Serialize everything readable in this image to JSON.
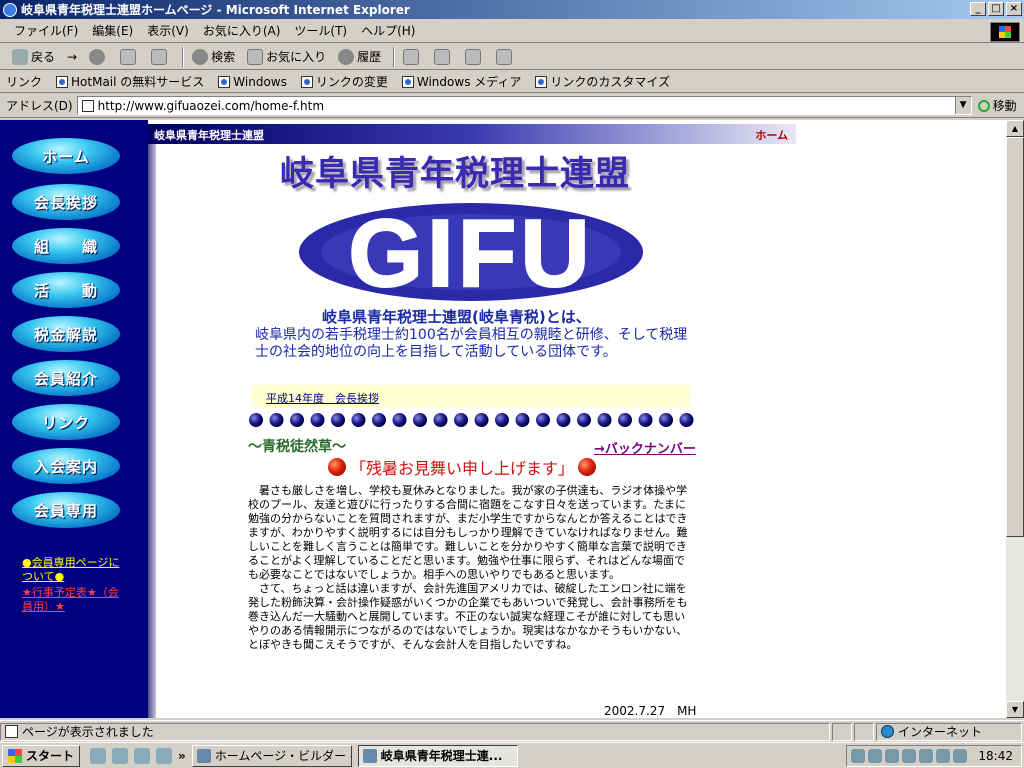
{
  "window": {
    "title": "岐阜県青年税理士連盟ホームページ - Microsoft Internet Explorer",
    "min_label": "_",
    "max_label": "□",
    "close_label": "×"
  },
  "menu": [
    "ファイル(F)",
    "編集(E)",
    "表示(V)",
    "お気に入り(A)",
    "ツール(T)",
    "ヘルプ(H)"
  ],
  "toolbar": {
    "back": "戻る",
    "forward": "→",
    "search": "検索",
    "favorites": "お気に入り",
    "history": "履歴"
  },
  "links": {
    "label": "リンク",
    "items": [
      "HotMail の無料サービス",
      "Windows",
      "リンクの変更",
      "Windows メディア",
      "リンクのカスタマイズ"
    ]
  },
  "address": {
    "label": "アドレス(D)",
    "url": "http://www.gifuaozei.com/home-f.htm",
    "go": "移動"
  },
  "page": {
    "org_name": "岐阜県青年税理士連盟",
    "home_link": "ホーム",
    "title": "岐阜県青年税理士連盟",
    "logo_text": "GIFU",
    "intro_heading": "岐阜県青年税理士連盟(岐阜青税)とは、",
    "intro_body": "岐阜県内の若手税理士約100名が会員相互の親睦と研修、そして税理士の社会的地位の向上を目指して活動している団体です。",
    "greeting_link": "平成14年度　会長挨拶",
    "section_title": "～青税徒然草～",
    "back_number": "→バックナンバー",
    "headline": "「残暑お見舞い申し上げます」",
    "article_p1": "暑さも厳しさを増し、学校も夏休みとなりました。我が家の子供達も、ラジオ体操や学校のプール、友達と遊びに行ったりする合間に宿題をこなす日々を送っています。たまに勉強の分からないことを質問されますが、まだ小学生ですからなんとか答えることはできますが、わかりやすく説明するには自分もしっかり理解できていなければなりません。難しいことを難しく言うことは簡単です。難しいことを分かりやすく簡単な言葉で説明できることがよく理解していることだと思います。勉強や仕事に限らず、それはどんな場面でも必要なことではないでしょうか。相手への思いやりでもあると思います。",
    "article_p2": "さて、ちょっと話は違いますが、会計先進国アメリカでは、破綻したエンロン社に端を発した粉飾決算・会計操作疑惑がいくつかの企業でもあいついで発覚し、会計事務所をも巻き込んだ一大騒動へと展開しています。不正のない誠実な経理こそが誰に対しても思いやりのある情報開示につながるのではないでしょうか。現実はなかなかそうもいかない、とぼやきも聞こえそうですが、そんな会計人を目指したいですね。",
    "date": "2002.7.27　MH"
  },
  "sidebar": {
    "items": [
      "ホーム",
      "会長挨拶",
      "組　　織",
      "活　　動",
      "税金解説",
      "会員紹介",
      "リンク",
      "入会案内",
      "会員専用"
    ],
    "member_page_link": "●会員専用ページについて●",
    "schedule_link": "★行事予定表★（会員用）★"
  },
  "status": {
    "text": "ページが表示されました",
    "zone": "インターネット"
  },
  "taskbar": {
    "start": "スタート",
    "tasks": [
      "ホームページ・ビルダー - [li...",
      "岐阜県青年税理士連..."
    ],
    "clock": "18:42",
    "chevron": "»"
  },
  "colors": {
    "sidebar_bg": "#000080",
    "title_color": "#3a2ab0",
    "text_blue": "#1a2aa8",
    "headline_red": "#d01010"
  }
}
